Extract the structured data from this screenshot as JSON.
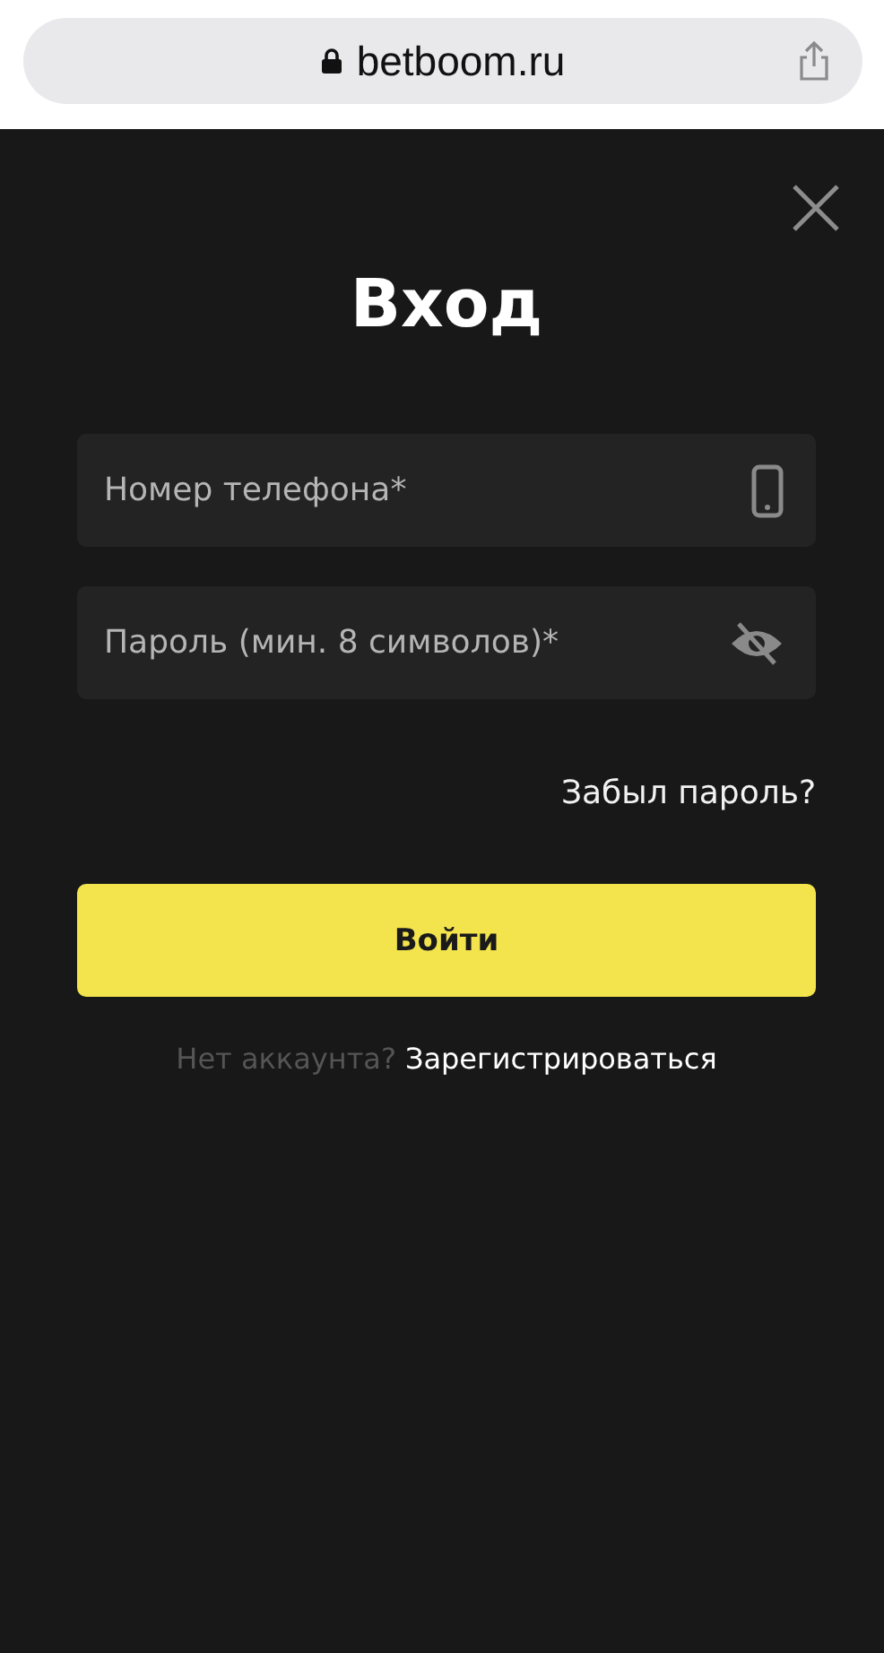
{
  "browser": {
    "address": "betboom.ru"
  },
  "dialog": {
    "title": "Вход",
    "fields": [
      {
        "kind": "phone",
        "placeholder": "Номер телефона*"
      },
      {
        "kind": "password",
        "placeholder": "Пароль (мин. 8 символов)*"
      }
    ],
    "forgot_link": "Забыл пароль?",
    "submit": "Войти",
    "register_prompt": "Нет аккаунта?",
    "register_link": "Зарегистрироваться"
  }
}
